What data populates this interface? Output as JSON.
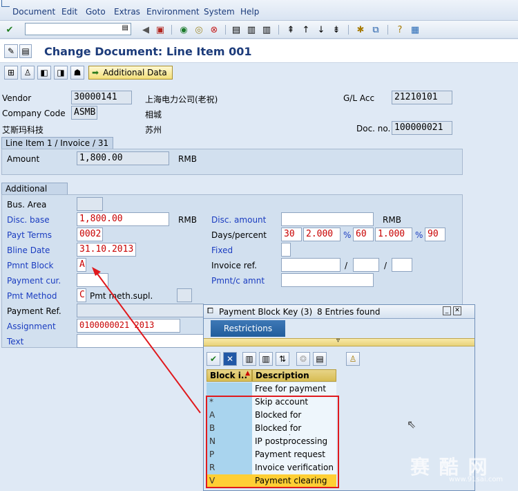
{
  "menu": [
    "Document",
    "Edit",
    "Goto",
    "Extras",
    "Environment",
    "System",
    "Help"
  ],
  "title": "Change Document: Line Item 001",
  "app_toolbar": {
    "additional_data_label": "Additional Data"
  },
  "header": {
    "vendor_label": "Vendor",
    "vendor_value": "30000141",
    "vendor_name": "上海电力公司(老祝)",
    "gl_label": "G/L Acc",
    "gl_value": "21210101",
    "company_label": "Company Code",
    "company_value": "ASMB",
    "company_city": "相城",
    "company_name": "艾斯玛科技",
    "company_city2": "苏州",
    "docno_label": "Doc. no.",
    "docno_value": "100000021"
  },
  "line_item": {
    "tab": "Line Item 1 / Invoice / 31",
    "amount_label": "Amount",
    "amount_value": "1,800.00",
    "currency": "RMB"
  },
  "additional": {
    "tab": "Additional Data",
    "bus_area_label": "Bus. Area",
    "disc_base_label": "Disc. base",
    "disc_base_value": "1,800.00",
    "disc_base_currency": "RMB",
    "disc_amount_label": "Disc. amount",
    "disc_amount_currency": "RMB",
    "payt_terms_label": "Payt Terms",
    "payt_terms_value": "0002",
    "days_percent_label": "Days/percent",
    "days1": "30",
    "pct1": "2.000",
    "days2": "60",
    "pct2": "1.000",
    "days3": "90",
    "pct_sign": "%",
    "bline_label": "Bline Date",
    "bline_value": "31.10.2013",
    "fixed_label": "Fixed",
    "pmnt_block_label": "Pmnt Block",
    "pmnt_block_value": "A",
    "invoice_ref_label": "Invoice ref.",
    "slash": "/",
    "payment_cur_label": "Payment cur.",
    "pmnt_c_amnt_label": "Pmnt/c amnt",
    "pmt_method_label": "Pmt Method",
    "pmt_method_value": "C",
    "pmt_meth_supl_label": "Pmt meth.supl.",
    "payment_ref_label": "Payment Ref.",
    "assignment_label": "Assignment",
    "assignment_value": "0100000021 2013",
    "text_label": "Text"
  },
  "popup": {
    "title": "Payment Block Key (3)",
    "entries_found": "8 Entries found",
    "restrictions_tab": "Restrictions",
    "col_block": "Block i..",
    "col_description": "Description",
    "rows": [
      {
        "key": "",
        "desc": "Free for payment"
      },
      {
        "key": "*",
        "desc": "Skip account"
      },
      {
        "key": "A",
        "desc": "Blocked for payment"
      },
      {
        "key": "B",
        "desc": "Blocked for payment"
      },
      {
        "key": "N",
        "desc": "IP postprocessing"
      },
      {
        "key": "P",
        "desc": "Payment request"
      },
      {
        "key": "R",
        "desc": "Invoice verification"
      },
      {
        "key": "V",
        "desc": "Payment clearing"
      }
    ],
    "selected_index": 7
  },
  "watermark": {
    "text": "赛 酷 网",
    "url": "www.91sai.com"
  },
  "icons": {
    "enter": "check-circle-icon",
    "save": "floppy-icon",
    "back": "back-arrow-icon",
    "exit": "exit-icon",
    "cancel": "cancel-icon",
    "help": "help-icon"
  }
}
